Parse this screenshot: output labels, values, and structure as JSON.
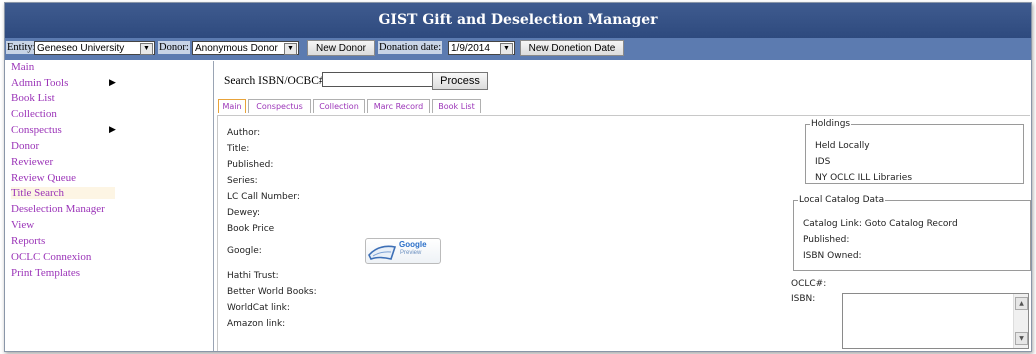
{
  "app": {
    "title": "GIST Gift and Deselection Manager"
  },
  "toolbar": {
    "entity_label": "Entity:",
    "entity_value": "Geneseo University",
    "donor_label": "Donor:",
    "donor_value": "Anonymous Donor",
    "new_donor": "New Donor",
    "donation_date_label": "Donation date:",
    "donation_date_value": "1/9/2014",
    "new_donation_date": "New Donetion Date"
  },
  "sidebar": {
    "items": [
      {
        "label": "Main",
        "submenu": false,
        "active": false
      },
      {
        "label": "Admin Tools",
        "submenu": true,
        "active": false
      },
      {
        "label": "Book List",
        "submenu": false,
        "active": false
      },
      {
        "label": "Collection",
        "submenu": false,
        "active": false
      },
      {
        "label": "Conspectus",
        "submenu": true,
        "active": false
      },
      {
        "label": "Donor",
        "submenu": false,
        "active": false
      },
      {
        "label": "Reviewer",
        "submenu": false,
        "active": false
      },
      {
        "label": "Review Queue",
        "submenu": false,
        "active": false
      },
      {
        "label": "Title Search",
        "submenu": false,
        "active": true
      },
      {
        "label": "Deselection Manager",
        "submenu": false,
        "active": false
      },
      {
        "label": "View",
        "submenu": false,
        "active": false
      },
      {
        "label": "Reports",
        "submenu": false,
        "active": false
      },
      {
        "label": "OCLC Connexion",
        "submenu": false,
        "active": false
      },
      {
        "label": "Print Templates",
        "submenu": false,
        "active": false
      }
    ]
  },
  "search": {
    "label": "Search ISBN/OCBC#",
    "value": "",
    "process": "Process"
  },
  "tabs": [
    {
      "label": "Main",
      "active": true
    },
    {
      "label": "Conspectus",
      "active": false
    },
    {
      "label": "Collection",
      "active": false
    },
    {
      "label": "Marc Record",
      "active": false
    },
    {
      "label": "Book List",
      "active": false
    }
  ],
  "fields": {
    "author": "Author:",
    "title": "Title:",
    "published": "Published:",
    "series": "Series:",
    "lc_call": "LC Call Number:",
    "dewey": "Dewey:",
    "book_price": "Book Price",
    "google": "Google:",
    "google_btn_text": "Google",
    "google_btn_sub": "Preview",
    "hathi": "Hathi Trust:",
    "better_world": "Better World Books:",
    "worldcat": "WorldCat link:",
    "amazon": "Amazon link:"
  },
  "holdings": {
    "legend": "Holdings",
    "lines": [
      "Held Locally",
      "IDS",
      "NY OCLC ILL Libraries"
    ]
  },
  "local_catalog": {
    "legend": "Local Catalog Data",
    "catalog_link_label": "Catalog Link:",
    "catalog_link_text": "Goto Catalog Record",
    "published": "Published:",
    "isbn_owned": "ISBN Owned:"
  },
  "oclc": {
    "oclc_label": "OCLC#:",
    "isbn_label": "ISBN:"
  },
  "colors": {
    "titlebar": "#3f5b8f",
    "toolbar": "#5c7bb0",
    "link": "#9b34b8",
    "active_tab_border": "#e8a33a"
  }
}
